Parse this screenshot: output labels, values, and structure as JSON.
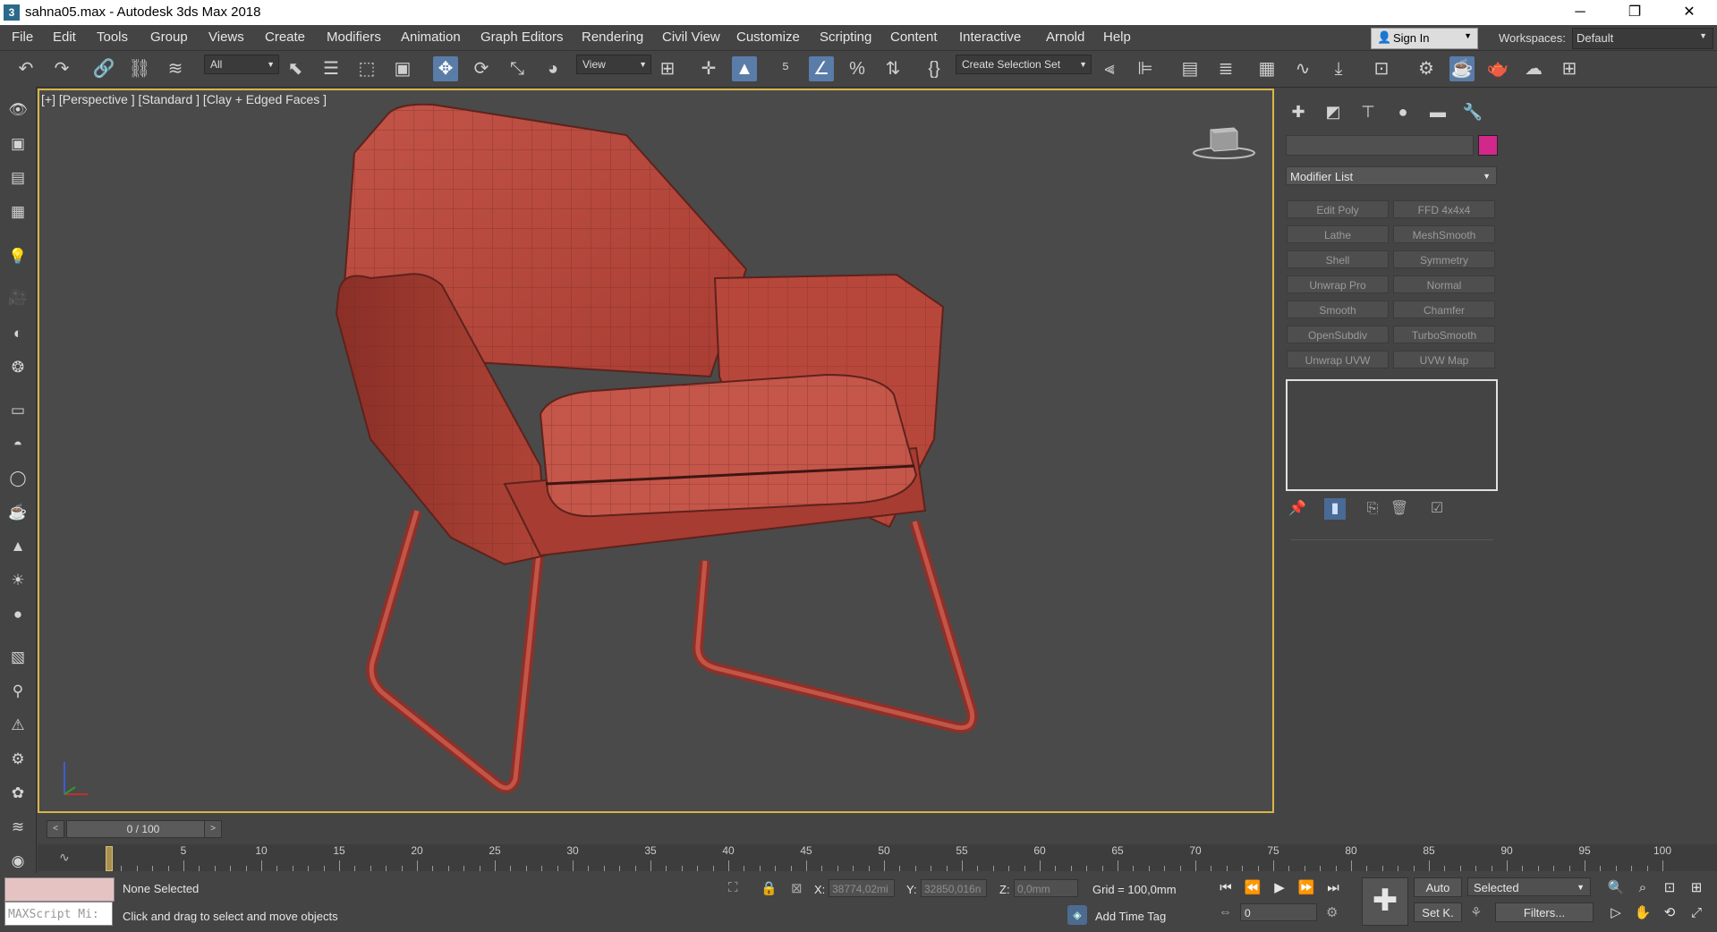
{
  "window": {
    "title": "sahna05.max - Autodesk 3ds Max 2018",
    "app_icon": "3",
    "controls": {
      "minimize": "─",
      "restore": "❐",
      "close": "✕"
    }
  },
  "menu": {
    "items": [
      "File",
      "Edit",
      "Tools",
      "Group",
      "Views",
      "Create",
      "Modifiers",
      "Animation",
      "Graph Editors",
      "Rendering",
      "Civil View",
      "Customize",
      "Scripting",
      "Content",
      "Interactive",
      "Arnold",
      "Help"
    ],
    "sign_in": "Sign In",
    "workspaces_label": "Workspaces:",
    "workspace_value": "Default"
  },
  "toolbar": {
    "selection_filter": "All",
    "ref_coord": "View",
    "create_selection_set": "Create Selection Set"
  },
  "viewport": {
    "label": "[+] [Perspective ] [Standard ] [Clay + Edged Faces ]",
    "object_color": "#b5483d"
  },
  "command_panel": {
    "object_color": "#d2288c",
    "modifier_list": "Modifier List",
    "modifiers": [
      "Edit Poly",
      "FFD 4x4x4",
      "Lathe",
      "MeshSmooth",
      "Shell",
      "Symmetry",
      "Unwrap Pro",
      "Normal",
      "Smooth",
      "Chamfer",
      "OpenSubdiv",
      "TurboSmooth",
      "Unwrap UVW",
      "UVW Map"
    ]
  },
  "time_slider": {
    "frame_text": "0 / 100",
    "prev": "<",
    "next": ">"
  },
  "trackbar": {
    "ticks": [
      "0",
      "5",
      "10",
      "15",
      "20",
      "25",
      "30",
      "35",
      "40",
      "45",
      "50",
      "55",
      "60",
      "65",
      "70",
      "75",
      "80",
      "85",
      "90",
      "95",
      "100"
    ]
  },
  "status": {
    "listener_text": "MAXScript Mi:",
    "selection_status": "None Selected",
    "prompt": "Click and drag to select and move objects",
    "x_label": "X:",
    "x_value": "38774,02mi",
    "y_label": "Y:",
    "y_value": "32850,016n",
    "z_label": "Z:",
    "z_value": "0,0mm",
    "grid": "Grid = 100,0mm",
    "add_time_tag": "Add Time Tag",
    "frame_field": "0",
    "auto_key": "Auto",
    "set_key": "Set K.",
    "key_mode": "Selected",
    "filters": "Filters..."
  }
}
